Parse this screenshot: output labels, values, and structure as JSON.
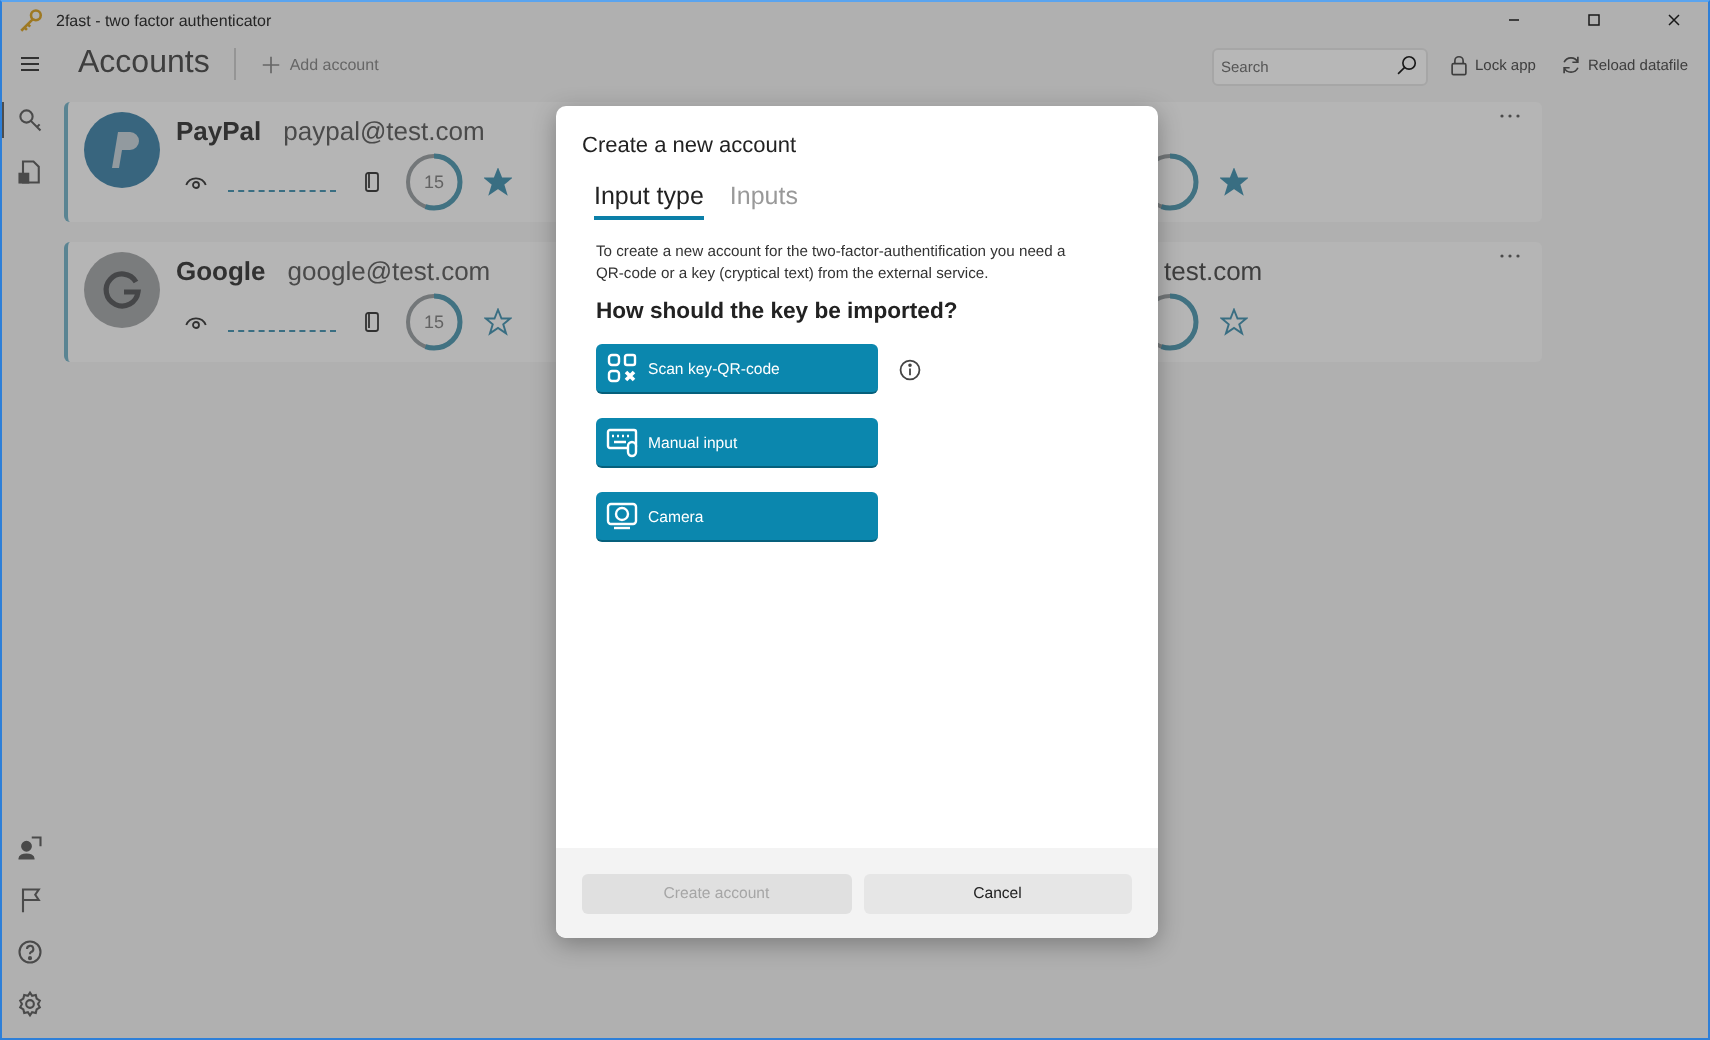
{
  "window": {
    "title": "2fast - two factor authenticator"
  },
  "header": {
    "title": "Accounts",
    "add_button": {
      "label": "Add account",
      "disabled": true
    },
    "search": {
      "placeholder": "Search"
    },
    "actions": [
      {
        "kind": "lock",
        "label": "Lock app"
      },
      {
        "kind": "reload",
        "label": "Reload datafile"
      }
    ]
  },
  "sidebar": {
    "top_items": [
      {
        "kind": "accounts",
        "selected": true
      },
      {
        "kind": "datafile",
        "selected": false
      }
    ],
    "bottom_items": [
      {
        "kind": "account-switch"
      },
      {
        "kind": "flag"
      },
      {
        "kind": "help"
      },
      {
        "kind": "settings"
      }
    ]
  },
  "accounts": [
    {
      "kind": "paypal",
      "name": "PayPal",
      "email": "paypal@test.com",
      "timer": "15",
      "level": 0.55,
      "favorite": true,
      "right": {
        "level": 0.55,
        "favorite": true
      }
    },
    {
      "kind": "google",
      "name": "Google",
      "email": "google@test.com",
      "timer": "15",
      "level": 0.55,
      "favorite": false,
      "right": {
        "email_tail": "test.com",
        "level": 0.55,
        "favorite": false
      }
    }
  ],
  "dialog": {
    "title": "Create a new account",
    "tabs": [
      {
        "label": "Input type",
        "selected": true
      },
      {
        "label": "Inputs",
        "selected": false
      }
    ],
    "description": "To create a new account for the two-factor-authentification you need a QR-code or a key (cryptical text) from the external service.",
    "question": "How should the key be imported?",
    "options": [
      {
        "kind": "qr",
        "label": "Scan key-QR-code",
        "info": true
      },
      {
        "kind": "keyboard",
        "label": "Manual input",
        "info": false
      },
      {
        "kind": "camera",
        "label": "Camera",
        "info": false
      }
    ],
    "buttons": [
      {
        "label": "Create account",
        "disabled": true
      },
      {
        "label": "Cancel",
        "disabled": false
      }
    ]
  }
}
